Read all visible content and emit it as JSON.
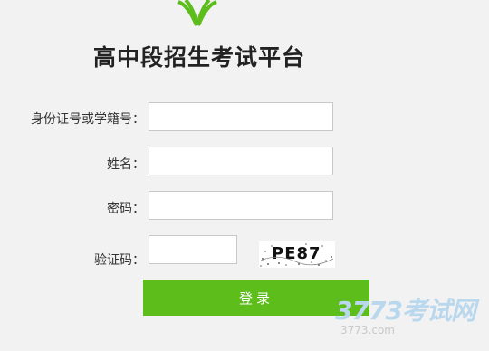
{
  "brand": {
    "logo_icon": "leaf-logo-icon"
  },
  "title": "高中段招生考试平台",
  "form": {
    "id_label": "身份证号或学籍号：",
    "id_value": "",
    "name_label": "姓名：",
    "name_value": "",
    "password_label": "密码：",
    "password_value": "",
    "captcha_label": "验证码：",
    "captcha_value": "",
    "captcha_image_text": "PE87"
  },
  "login_button": "登录",
  "colors": {
    "accent": "#5cbd1b",
    "background": "#f2f2f2"
  },
  "watermark": {
    "main": "3773考试网",
    "sub": "3773.com"
  }
}
